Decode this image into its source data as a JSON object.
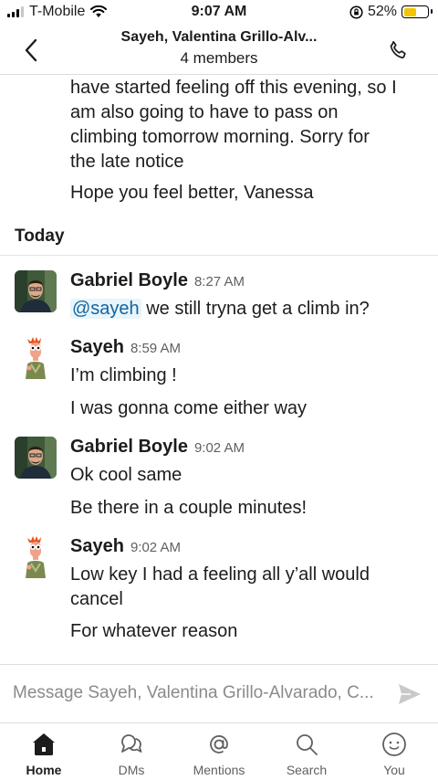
{
  "status_bar": {
    "carrier": "T-Mobile",
    "time": "9:07 AM",
    "battery": "52%",
    "battery_level": 0.52,
    "battery_color": "#f4c400"
  },
  "header": {
    "title": "Sayeh, Valentina Grillo-Alv...",
    "subtitle": "4 members",
    "back_icon": "chevron-left-icon",
    "call_icon": "phone-icon"
  },
  "earlier_lines": [
    "have started feeling off this evening, so I",
    "am also going to have to pass on",
    "climbing tomorrow morning. Sorry for",
    "the late notice"
  ],
  "earlier_followup": "Hope you feel better, Vanessa",
  "day_label": "Today",
  "messages": [
    {
      "sender": "Gabriel Boyle",
      "time": "8:27 AM",
      "mention": "@sayeh",
      "text": " we still tryna get a climb in?"
    },
    {
      "sender": "Sayeh",
      "time": "8:59 AM",
      "text": "I’m climbing !",
      "followup": "I was gonna come either way"
    },
    {
      "sender": "Gabriel Boyle",
      "time": "9:02 AM",
      "text": "Ok cool same",
      "followup": "Be there in a couple minutes!"
    },
    {
      "sender": "Sayeh",
      "time": "9:02 AM",
      "text_lines": [
        "Low key I had a feeling all y’all would",
        "cancel"
      ],
      "followup": "For whatever reason"
    }
  ],
  "composer": {
    "placeholder": "Message Sayeh, Valentina Grillo-Alvarado, C...",
    "send_icon": "send-icon"
  },
  "tabs": [
    {
      "label": "Home",
      "icon": "home-icon",
      "active": true
    },
    {
      "label": "DMs",
      "icon": "dms-icon",
      "active": false
    },
    {
      "label": "Mentions",
      "icon": "at-icon",
      "active": false
    },
    {
      "label": "Search",
      "icon": "search-icon",
      "active": false
    },
    {
      "label": "You",
      "icon": "you-icon",
      "active": false
    }
  ],
  "colors": {
    "mention_text": "#1264a3",
    "mention_bg": "#e8f5fa",
    "divider": "#dddddd"
  }
}
